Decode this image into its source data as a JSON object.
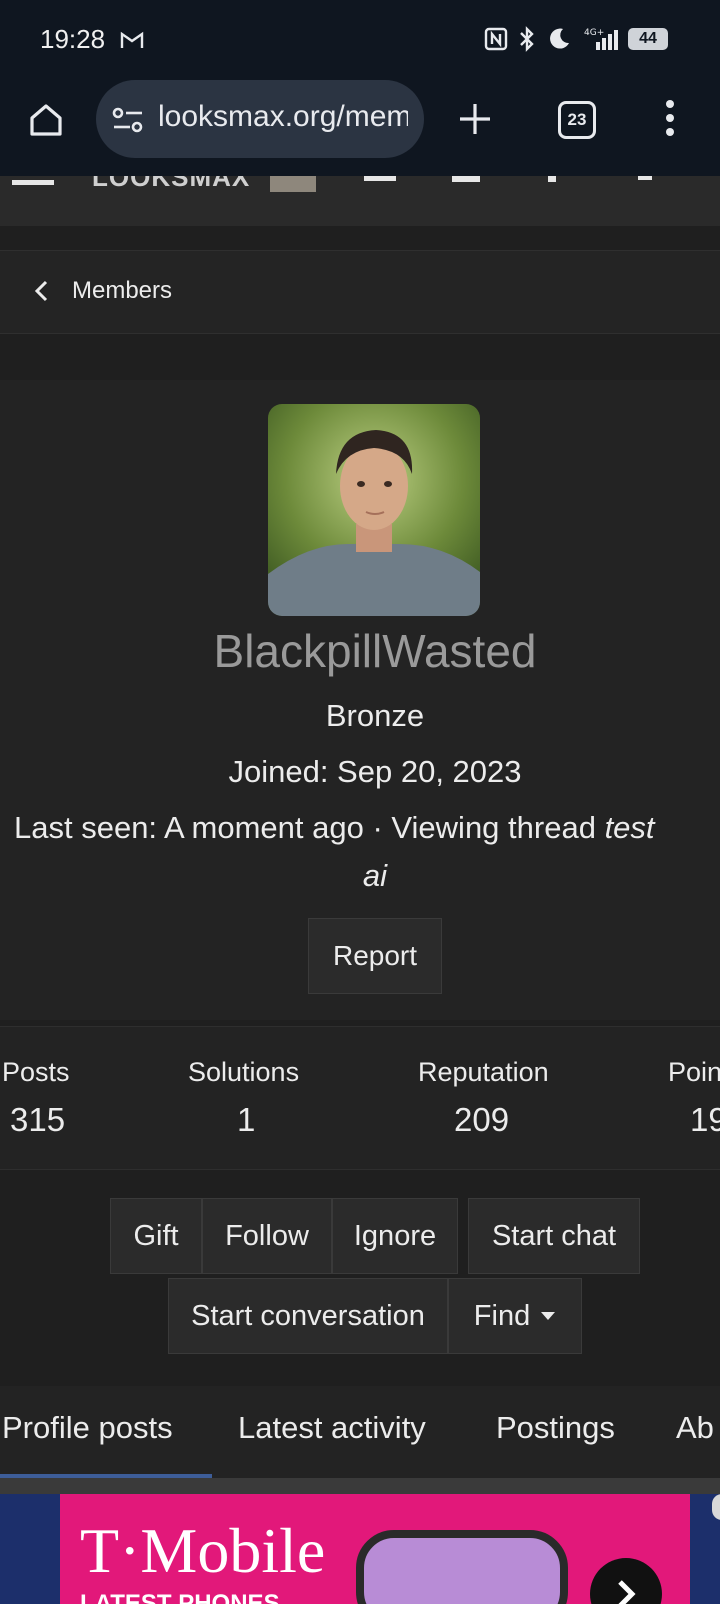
{
  "status_bar": {
    "time": "19:28",
    "battery": "44",
    "network": "4G+"
  },
  "browser": {
    "url": "looksmax.org/members/blackpillwasted",
    "tab_count": "23"
  },
  "breadcrumb": {
    "label": "Members"
  },
  "profile": {
    "username": "BlackpillWasted",
    "rank": "Bronze",
    "joined": "Joined: Sep 20, 2023",
    "last_seen_label": "Last seen: A moment ago",
    "separator": "·",
    "activity_prefix": "Viewing thread",
    "thread_title_start": "test",
    "thread_title_end": "ai",
    "report_label": "Report"
  },
  "stats": [
    {
      "label": "Posts",
      "value": "315"
    },
    {
      "label": "Solutions",
      "value": "1"
    },
    {
      "label": "Reputation",
      "value": "209"
    },
    {
      "label": "Poin",
      "value": "19"
    }
  ],
  "actions": {
    "gift": "Gift",
    "follow": "Follow",
    "ignore": "Ignore",
    "start_chat": "Start chat",
    "start_conversation": "Start conversation",
    "find": "Find"
  },
  "tabs": [
    "Profile posts",
    "Latest activity",
    "Postings",
    "Ab"
  ],
  "ad": {
    "brand": "T·Mobile",
    "sub": "LATEST PHONES"
  },
  "colors": {
    "accent_tab": "#3d5d98",
    "username": "#9a9a9a",
    "ad_magenta": "#e2187a"
  }
}
